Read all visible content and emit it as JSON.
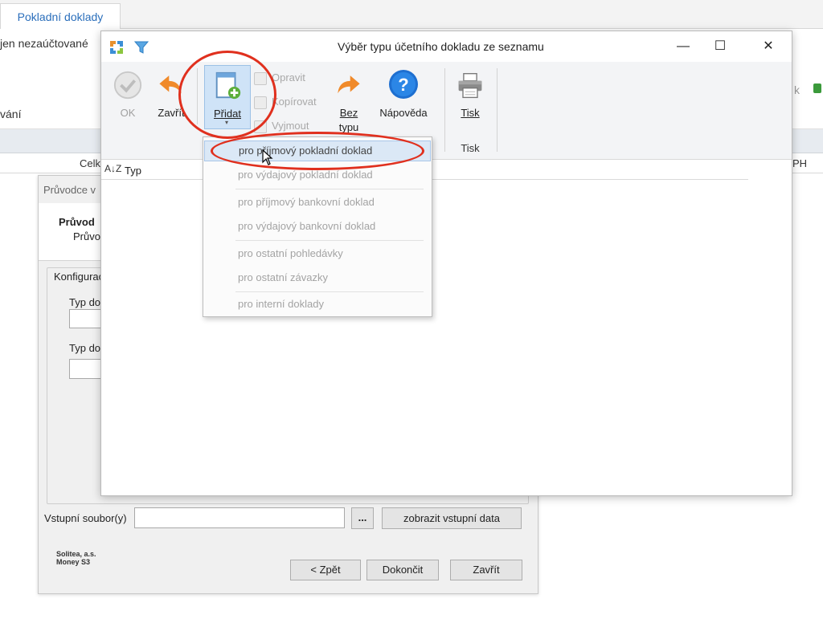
{
  "background_app": {
    "tab_label": "Pokladní doklady",
    "ribbon_text_1": "jen nezaúčtované",
    "ribbon_text_2": "vání",
    "column_celk": "Celk",
    "column_dph": "PH",
    "right_k": "k"
  },
  "wizard": {
    "title": "Průvodce v",
    "header_title": "Průvod",
    "header_subtitle": "Průvo",
    "group_label": "Konfigurac",
    "field1_label": "Typ do",
    "field2_label": "Typ do",
    "input_file_label": "Vstupní soubor(y)",
    "browse_label": "...",
    "show_input_label": "zobrazit vstupní data",
    "brand_line1": "Solitea, a.s.",
    "brand_line2": "Money S3",
    "back_label": "< Zpět",
    "finish_label": "Dokončit",
    "close_label": "Zavřít"
  },
  "dialog": {
    "title": "Výběr typu účetního dokladu ze seznamu",
    "window_buttons": {
      "minimize": "—",
      "maximize": "☐",
      "close": "✕"
    },
    "toolbar": {
      "ok": "OK",
      "close": "Zavřít",
      "add": "Přidat",
      "edit": "Opravit",
      "copy": "Kopírovat",
      "cut": "Vyjmout",
      "no_type_1": "Bez",
      "no_type_2": "typu",
      "help": "Nápověda",
      "print": "Tisk",
      "print_group": "Tisk"
    },
    "grid": {
      "sort_label": "A↓Z",
      "column_type": "Typ"
    }
  },
  "add_menu": {
    "items": [
      "pro příjmový pokladní doklad",
      "pro výdajový pokladní doklad",
      "pro příjmový bankovní doklad",
      "pro výdajový bankovní doklad",
      "pro ostatní pohledávky",
      "pro ostatní závazky",
      "pro interní doklady"
    ],
    "highlighted_index": 0
  },
  "colors": {
    "accent_blue": "#2a6ebb",
    "annotation_red": "#e0301e",
    "menu_highlight": "#dbe8f6"
  }
}
